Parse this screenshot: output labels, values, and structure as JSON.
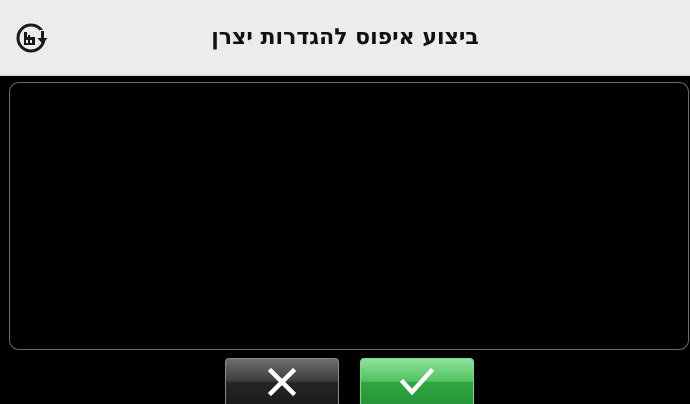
{
  "header": {
    "title": "ביצוע איפוס להגדרות יצרן",
    "icon": "factory-reset-icon"
  },
  "buttons": {
    "cancel_icon": "close-icon",
    "confirm_icon": "checkmark-icon"
  },
  "colors": {
    "header_bg": "#ececec",
    "screen_bg": "#000000",
    "confirm_green": "#3cb84e",
    "cancel_dark": "#2a2a2a"
  }
}
